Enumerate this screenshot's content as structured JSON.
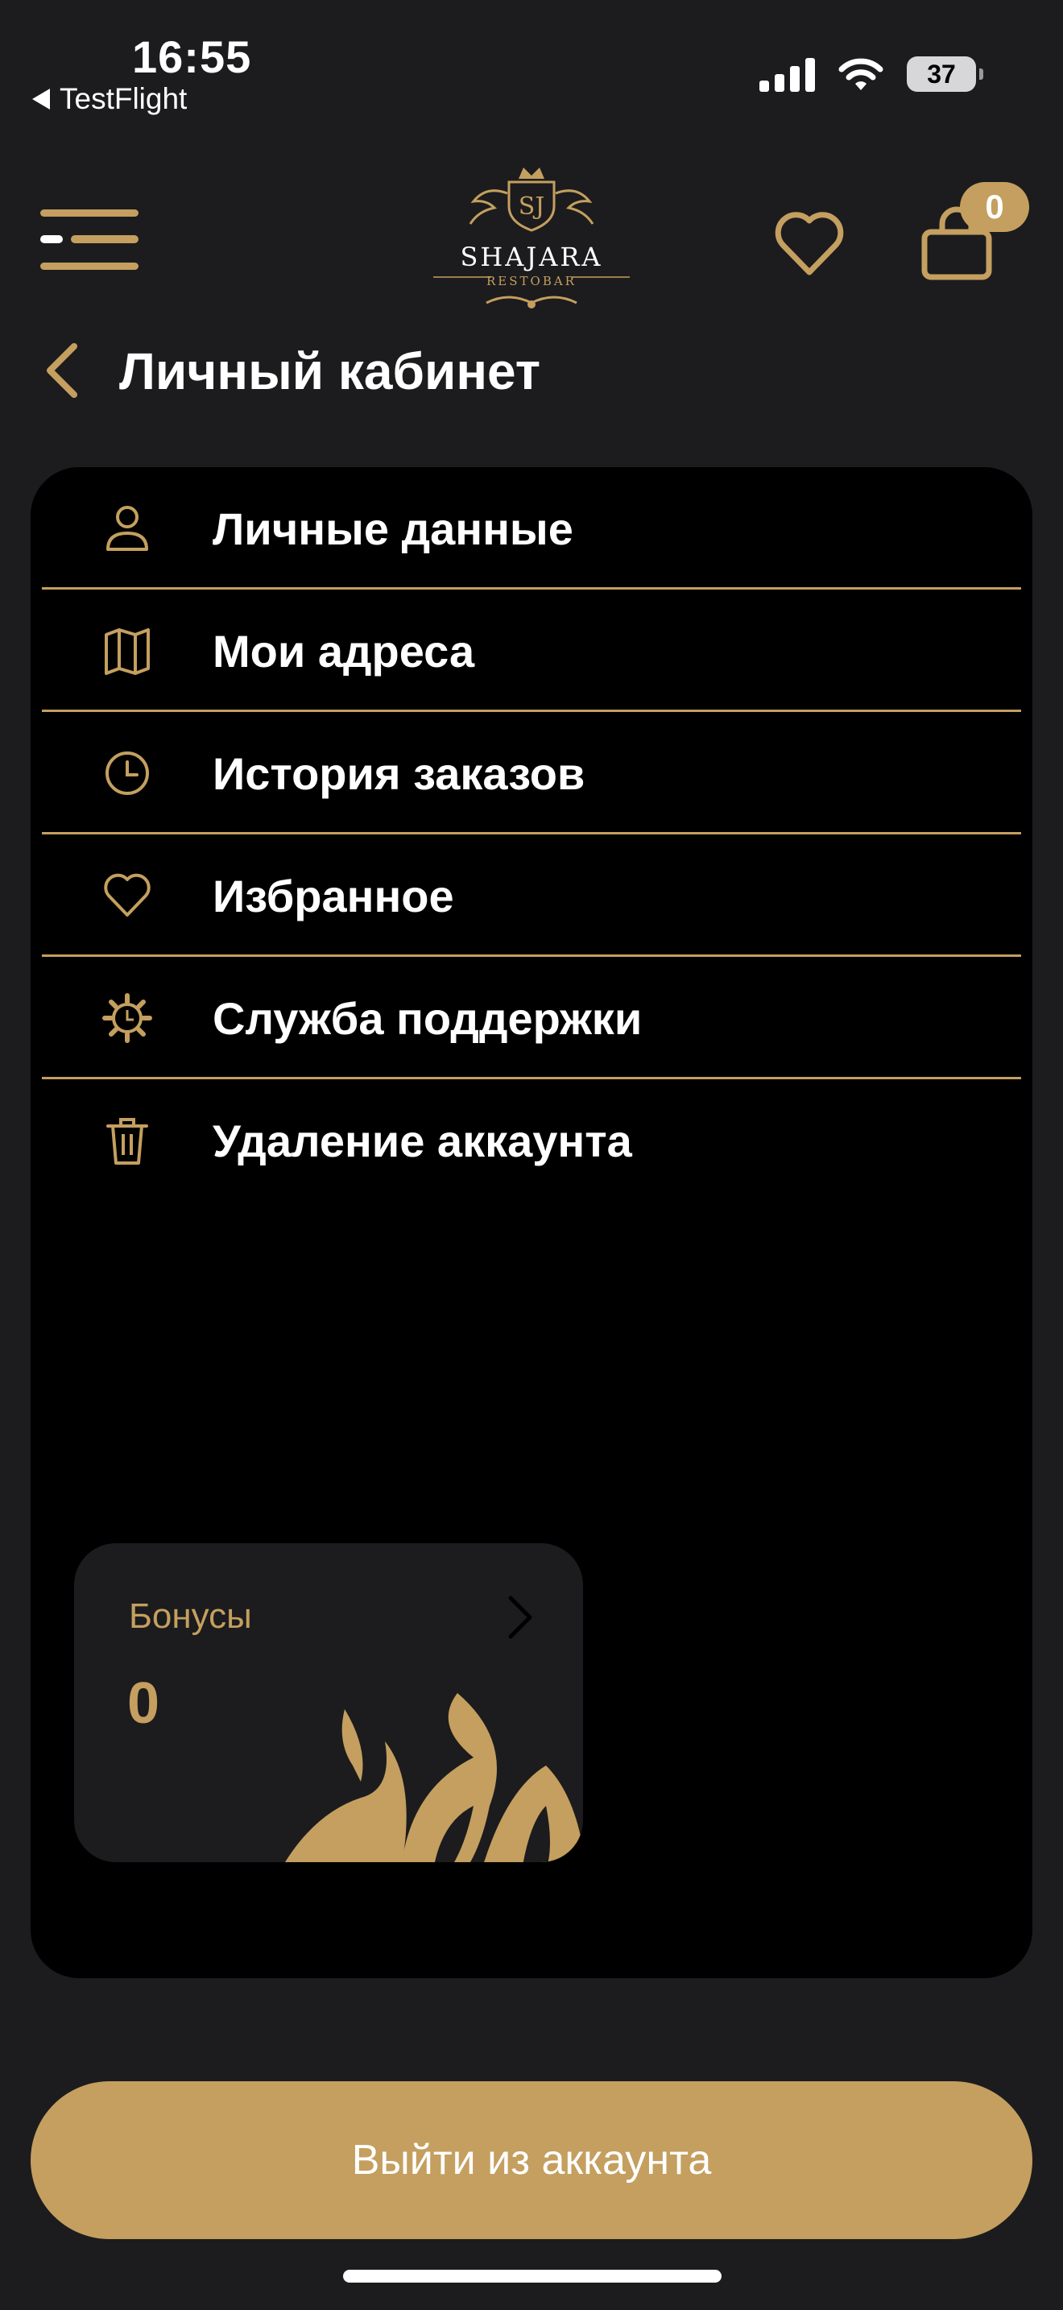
{
  "status_bar": {
    "time": "16:55",
    "back_app": "TestFlight",
    "battery": "37"
  },
  "header": {
    "logo_text": "SHAJARA",
    "logo_sub": "RESTOBAR",
    "logo_monogram": "SJ",
    "cart_count": "0"
  },
  "page": {
    "title": "Личный кабинет"
  },
  "menu": {
    "items": [
      {
        "label": "Личные данные",
        "icon": "user-icon"
      },
      {
        "label": "Мои адреса",
        "icon": "map-icon"
      },
      {
        "label": "История заказов",
        "icon": "clock-icon"
      },
      {
        "label": "Избранное",
        "icon": "heart-icon"
      },
      {
        "label": "Служба поддержки",
        "icon": "gear-icon"
      },
      {
        "label": "Удаление аккаунта",
        "icon": "trash-icon"
      }
    ]
  },
  "bonus": {
    "label": "Бонусы",
    "value": "0"
  },
  "logout": {
    "label": "Выйти из аккаунта"
  },
  "colors": {
    "background": "#1c1c1e",
    "accent": "#c49f5f",
    "card": "#000000",
    "text": "#ffffff"
  }
}
